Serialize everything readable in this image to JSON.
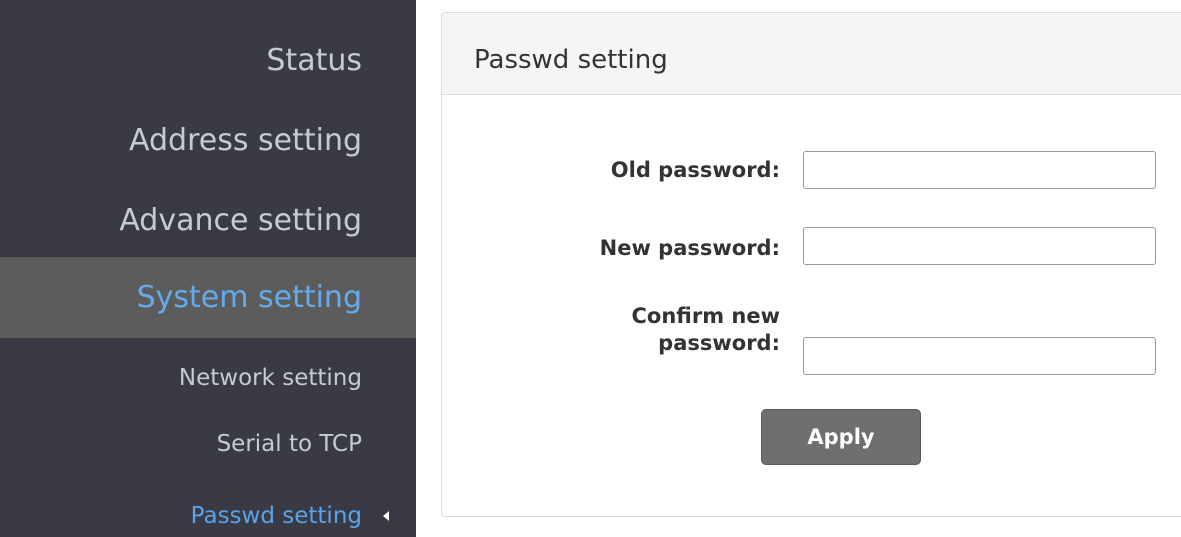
{
  "sidebar": {
    "items": [
      {
        "label": "Status"
      },
      {
        "label": "Address setting"
      },
      {
        "label": "Advance setting"
      },
      {
        "label": "System setting"
      },
      {
        "label": "Network setting"
      },
      {
        "label": "Serial to TCP"
      },
      {
        "label": "Passwd setting"
      }
    ]
  },
  "panel": {
    "title": "Passwd setting",
    "fields": [
      {
        "label": "Old password:",
        "value": ""
      },
      {
        "label": "New password:",
        "value": ""
      },
      {
        "label_line1": "Confirm new",
        "label_line2": "password:",
        "value": ""
      }
    ],
    "apply_label": "Apply"
  },
  "colors": {
    "sidebar_bg": "#3a3a44",
    "active_bg": "#5c5c5c",
    "active_text": "#66aaee",
    "nav_text": "#c6cbd1",
    "button_bg": "#6f6f6f"
  }
}
